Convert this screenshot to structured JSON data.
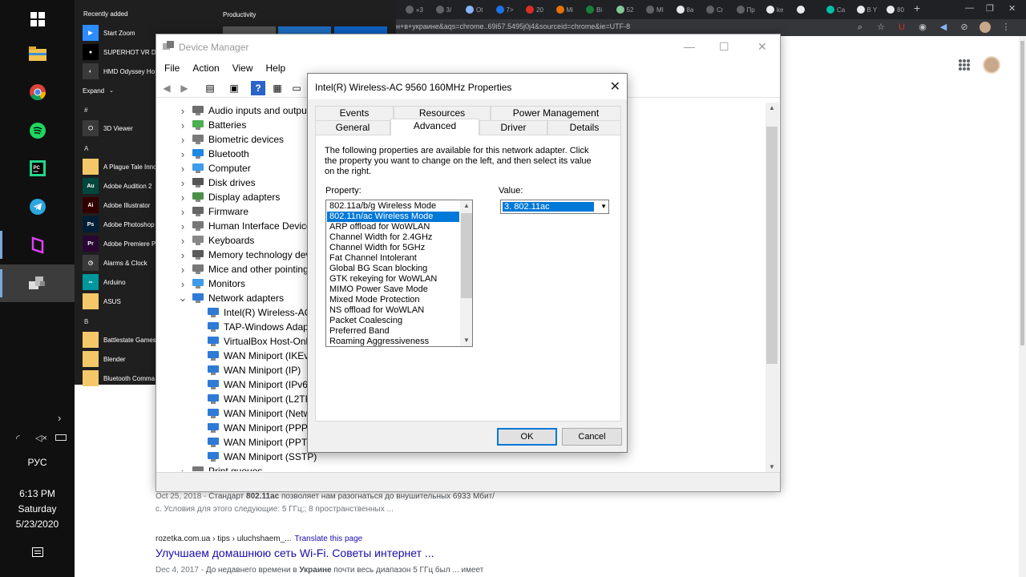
{
  "chrome": {
    "tabs": [
      {
        "label": "«3",
        "color": "#5f6368"
      },
      {
        "label": "3/",
        "color": "#5f6368"
      },
      {
        "label": "Ot",
        "color": "#8ab4f8"
      },
      {
        "label": "7>",
        "color": "#1a73e8"
      },
      {
        "label": "20",
        "color": "#d93025"
      },
      {
        "label": "Mi",
        "color": "#e8710a"
      },
      {
        "label": "Bi",
        "color": "#188038"
      },
      {
        "label": "52",
        "color": "#81c995"
      },
      {
        "label": "MI",
        "color": "#5f6368"
      },
      {
        "label": "8a",
        "color": "#e8eaed"
      },
      {
        "label": "Cr",
        "color": "#5f6368"
      },
      {
        "label": "Пр",
        "color": "#5f6368"
      },
      {
        "label": "ke",
        "color": "#e8eaed"
      },
      {
        "label": "",
        "color": "#e8eaed"
      },
      {
        "label": "Ca",
        "color": "#00bfa5"
      },
      {
        "label": "B Y",
        "color": "#e8eaed"
      },
      {
        "label": "80",
        "color": "#e8eaed"
      }
    ],
    "url": "н+в+украине&aqs=chrome..69i57.5495j0j4&sourceid=chrome&ie=UTF-8"
  },
  "search": {
    "snippet1_date": "Oct 25, 2018 - ",
    "snippet1_pre": "Стандарт ",
    "snippet1_bold": "802.11ac",
    "snippet1_post": " позволяет нам разогнаться до внушительных 6933 Мбит/",
    "snippet1_line2": "с. Условия для этого следующие: 5 ГГц;; 8 пространственных ...",
    "result_url": "rozetka.com.ua › tips › uluchshaem_...",
    "translate": "Translate this page",
    "result_title": "Улучшаем домашнюю сеть Wi-Fi. Советы интернет ...",
    "snippet2_date": "Dec 4, 2017 - ",
    "snippet2_pre": "До недавнего времени в ",
    "snippet2_bold": "Украине",
    "snippet2_post": " почти весь диапазон 5 ГГц был ... имеет"
  },
  "taskbar": {
    "lang": "РУС",
    "time": "6:13 PM",
    "day": "Saturday",
    "date": "5/23/2020"
  },
  "startmenu": {
    "recently_added": "Recently added",
    "productivity": "Productivity",
    "expand": "Expand",
    "recent": [
      {
        "label": "Start Zoom",
        "icon": "zoom-icon",
        "color": "#2d8cff",
        "glyph": "▶"
      },
      {
        "label": "SUPERHOT VR DE",
        "icon": "superhot-icon",
        "color": "#000000",
        "glyph": "●"
      },
      {
        "label": "HMD Odyssey Ho",
        "icon": "hmd-icon",
        "color": "#3a3a3a",
        "glyph": "◐"
      }
    ],
    "letters": [
      "#",
      "A",
      "B"
    ],
    "apps": [
      {
        "label": "3D Viewer",
        "icon": "3d-viewer-icon",
        "color": "#3a3a3a",
        "glyph": "⬡"
      },
      {
        "label": "A Plague Tale Inno",
        "icon": "folder-icon",
        "color": "#f4c86a",
        "glyph": ""
      },
      {
        "label": "Adobe Audition 2",
        "icon": "audition-icon",
        "color": "#00473e",
        "glyph": "Au"
      },
      {
        "label": "Adobe Illustrator",
        "icon": "illustrator-icon",
        "color": "#330000",
        "glyph": "Ai"
      },
      {
        "label": "Adobe Photoshop",
        "icon": "photoshop-icon",
        "color": "#001e36",
        "glyph": "Ps"
      },
      {
        "label": "Adobe Premiere P",
        "icon": "premiere-icon",
        "color": "#2a0634",
        "glyph": "Pr"
      },
      {
        "label": "Alarms & Clock",
        "icon": "alarm-icon",
        "color": "#3a3a3a",
        "glyph": "◷"
      },
      {
        "label": "Arduino",
        "icon": "arduino-icon",
        "color": "#00979c",
        "glyph": "∞"
      },
      {
        "label": "ASUS",
        "icon": "folder-icon",
        "color": "#f4c86a",
        "glyph": ""
      },
      {
        "label": "Battlestate Games",
        "icon": "folder-icon",
        "color": "#f4c86a",
        "glyph": ""
      },
      {
        "label": "Blender",
        "icon": "folder-icon",
        "color": "#f4c86a",
        "glyph": ""
      },
      {
        "label": "Bluetooth Comma",
        "icon": "folder-icon",
        "color": "#f4c86a",
        "glyph": ""
      }
    ]
  },
  "device_manager": {
    "title": "Device Manager",
    "menu": [
      "File",
      "Action",
      "View",
      "Help"
    ],
    "tree": [
      {
        "label": "Audio inputs and outpu",
        "level": 0,
        "icon": "audio-icon",
        "color": "#6e6e6e"
      },
      {
        "label": "Batteries",
        "level": 0,
        "icon": "battery-icon",
        "color": "#4caf50"
      },
      {
        "label": "Biometric devices",
        "level": 0,
        "icon": "biometric-icon",
        "color": "#7a7a7a"
      },
      {
        "label": "Bluetooth",
        "level": 0,
        "icon": "bluetooth-icon",
        "color": "#1e88e5"
      },
      {
        "label": "Computer",
        "level": 0,
        "icon": "computer-icon",
        "color": "#3d9be9"
      },
      {
        "label": "Disk drives",
        "level": 0,
        "icon": "disk-icon",
        "color": "#555555"
      },
      {
        "label": "Display adapters",
        "level": 0,
        "icon": "display-adapter-icon",
        "color": "#4a8f4a"
      },
      {
        "label": "Firmware",
        "level": 0,
        "icon": "firmware-icon",
        "color": "#666666"
      },
      {
        "label": "Human Interface Device",
        "level": 0,
        "icon": "hid-icon",
        "color": "#777777"
      },
      {
        "label": "Keyboards",
        "level": 0,
        "icon": "keyboard-icon",
        "color": "#888888"
      },
      {
        "label": "Memory technology dev",
        "level": 0,
        "icon": "memory-icon",
        "color": "#5a5a5a"
      },
      {
        "label": "Mice and other pointing",
        "level": 0,
        "icon": "mouse-icon",
        "color": "#777777"
      },
      {
        "label": "Monitors",
        "level": 0,
        "icon": "monitor-icon",
        "color": "#3d9be9"
      },
      {
        "label": "Network adapters",
        "level": 0,
        "icon": "network-icon",
        "color": "#2e7bd6",
        "expanded": true
      },
      {
        "label": "Intel(R) Wireless-AC 9",
        "level": 1,
        "icon": "network-adapter-icon",
        "color": "#2e7bd6"
      },
      {
        "label": "TAP-Windows Adapte",
        "level": 1,
        "icon": "network-adapter-icon",
        "color": "#2e7bd6"
      },
      {
        "label": "VirtualBox Host-Only",
        "level": 1,
        "icon": "network-adapter-icon",
        "color": "#2e7bd6"
      },
      {
        "label": "WAN Miniport (IKEv2",
        "level": 1,
        "icon": "network-adapter-icon",
        "color": "#2e7bd6"
      },
      {
        "label": "WAN Miniport (IP)",
        "level": 1,
        "icon": "network-adapter-icon",
        "color": "#2e7bd6"
      },
      {
        "label": "WAN Miniport (IPv6)",
        "level": 1,
        "icon": "network-adapter-icon",
        "color": "#2e7bd6"
      },
      {
        "label": "WAN Miniport (L2TP)",
        "level": 1,
        "icon": "network-adapter-icon",
        "color": "#2e7bd6"
      },
      {
        "label": "WAN Miniport (Netw",
        "level": 1,
        "icon": "network-adapter-icon",
        "color": "#2e7bd6"
      },
      {
        "label": "WAN Miniport (PPPO",
        "level": 1,
        "icon": "network-adapter-icon",
        "color": "#2e7bd6"
      },
      {
        "label": "WAN Miniport (PPTP",
        "level": 1,
        "icon": "network-adapter-icon",
        "color": "#2e7bd6"
      },
      {
        "label": "WAN Miniport (SSTP)",
        "level": 1,
        "icon": "network-adapter-icon",
        "color": "#2e7bd6"
      },
      {
        "label": "Print queues",
        "level": 0,
        "icon": "printer-icon",
        "color": "#777777"
      }
    ]
  },
  "dialog": {
    "title": "Intel(R) Wireless-AC 9560 160MHz Properties",
    "tabs_back": [
      "Events",
      "Resources",
      "Power Management"
    ],
    "tabs_front": [
      "General",
      "Advanced",
      "Driver",
      "Details"
    ],
    "selected_tab": "Advanced",
    "description": "The following properties are available for this network adapter. Click the property you want to change on the left, and then select its value on the right.",
    "property_label": "Property:",
    "value_label": "Value:",
    "properties": [
      "802.11a/b/g Wireless Mode",
      "802.11n/ac Wireless Mode",
      "ARP offload for WoWLAN",
      "Channel Width for 2.4GHz",
      "Channel Width for 5GHz",
      "Fat Channel Intolerant",
      "Global BG Scan blocking",
      "GTK rekeying for WoWLAN",
      "MIMO Power Save Mode",
      "Mixed Mode Protection",
      "NS offload for WoWLAN",
      "Packet Coalescing",
      "Preferred Band",
      "Roaming Aggressiveness"
    ],
    "selected_property": 1,
    "value": "3. 802.11ac",
    "ok": "OK",
    "cancel": "Cancel"
  }
}
